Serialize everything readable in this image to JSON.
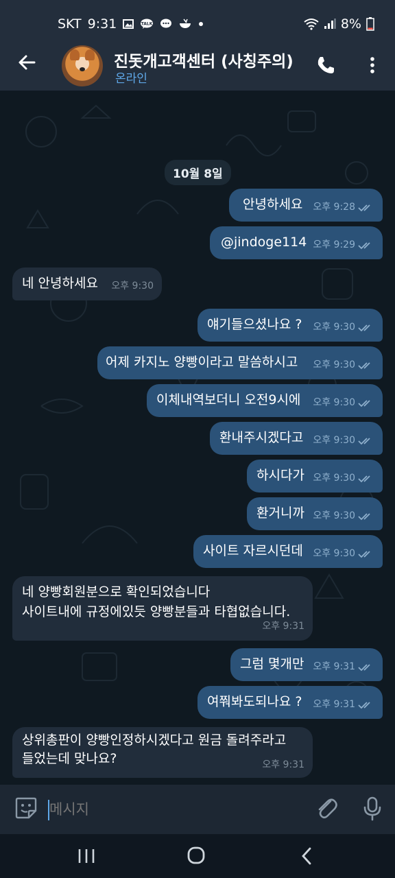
{
  "status_bar": {
    "carrier": "SKT",
    "time": "9:31",
    "battery": "8%",
    "icons": [
      "image-icon",
      "talk-icon",
      "chat-icon",
      "bowl-icon",
      "dot-icon",
      "wifi-icon",
      "signal-icon",
      "battery-icon"
    ]
  },
  "header": {
    "title": "진돗개고객센터 (사칭주의)",
    "status": "온라인"
  },
  "date_chip": "10월 8일",
  "messages": [
    {
      "dir": "out",
      "text": "안녕하세요",
      "time": "오후 9:28"
    },
    {
      "dir": "out",
      "text": "@jindoge114",
      "time": "오후 9:29"
    },
    {
      "dir": "in",
      "text": "네 안녕하세요",
      "time": "오후 9:30"
    },
    {
      "dir": "out",
      "text": "얘기들으셨나요 ?",
      "time": "오후 9:30"
    },
    {
      "dir": "out",
      "text": "어제 카지노 양빵이라고 말씀하시고",
      "time": "오후 9:30"
    },
    {
      "dir": "out",
      "text": "이체내역보더니 오전9시에",
      "time": "오후 9:30"
    },
    {
      "dir": "out",
      "text": "환내주시겠다고",
      "time": "오후 9:30"
    },
    {
      "dir": "out",
      "text": "하시다가",
      "time": "오후 9:30"
    },
    {
      "dir": "out",
      "text": "환거니까",
      "time": "오후 9:30"
    },
    {
      "dir": "out",
      "text": "사이트 자르시던데",
      "time": "오후 9:30"
    },
    {
      "dir": "in",
      "text": "네 양빵회원분으로 확인되었습니다\n사이트내에 규정에있듯 양빵분들과 타협없습니다.",
      "time": "오후 9:31"
    },
    {
      "dir": "out",
      "text": "그럼 몇개만",
      "time": "오후 9:31"
    },
    {
      "dir": "out",
      "text": "여쭤봐도되나요 ?",
      "time": "오후 9:31"
    },
    {
      "dir": "in",
      "text": "상위총판이 양빵인정하시겠다고 원금 돌려주라고\n들었는데 맞나요?",
      "time": "오후 9:31"
    }
  ],
  "composer": {
    "placeholder": "메시지"
  },
  "colors": {
    "outgoing_bubble": "#2b5278",
    "incoming_bubble": "#212d3b",
    "accent": "#5fa8e8",
    "background": "#0f1921"
  }
}
